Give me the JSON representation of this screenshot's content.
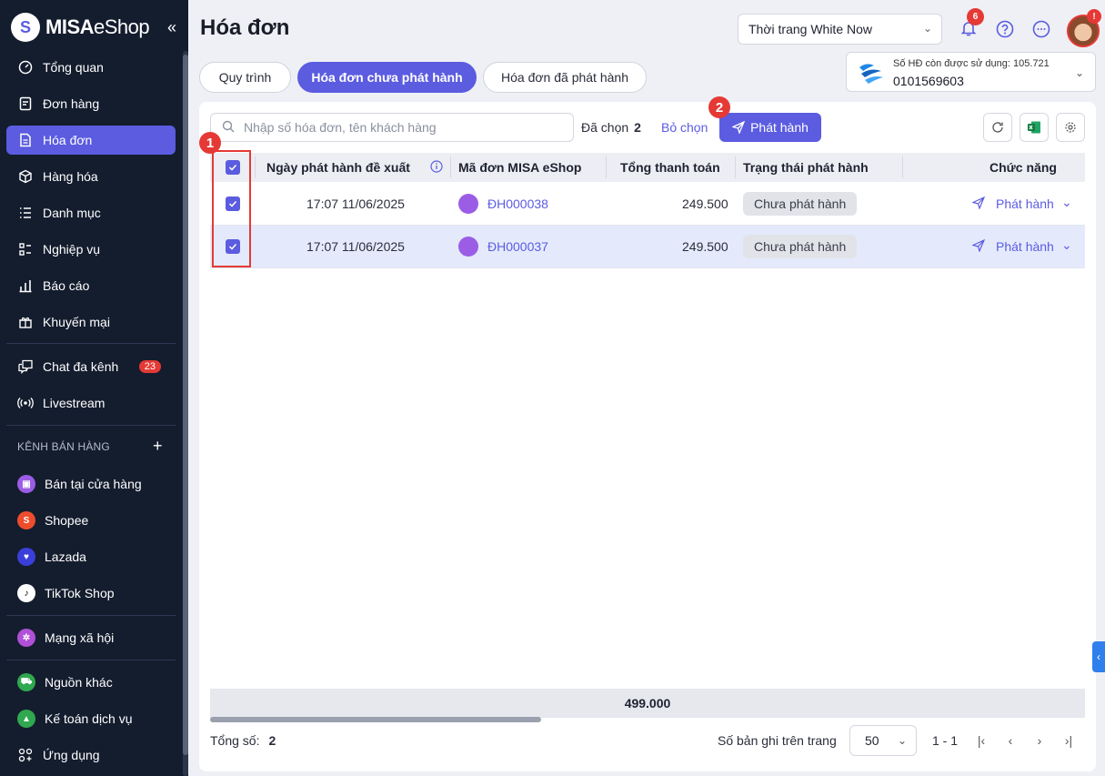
{
  "app": {
    "logo_main": "MISA",
    "logo_sub": "eShop",
    "collapse": "«"
  },
  "sidebar": {
    "items": [
      {
        "label": "Tổng quan"
      },
      {
        "label": "Đơn hàng"
      },
      {
        "label": "Hóa đơn"
      },
      {
        "label": "Hàng hóa"
      },
      {
        "label": "Danh mục"
      },
      {
        "label": "Nghiệp vụ"
      },
      {
        "label": "Báo cáo"
      },
      {
        "label": "Khuyến mại"
      },
      {
        "label": "Chat đa kênh",
        "badge": "23"
      },
      {
        "label": "Livestream"
      }
    ],
    "section_title": "KÊNH BÁN HÀNG",
    "section_add": "+",
    "channels": [
      {
        "label": "Bán tại cửa hàng",
        "color": "#9b5de5"
      },
      {
        "label": "Shopee",
        "color": "#ee4d2d"
      },
      {
        "label": "Lazada",
        "color": "#3a3fd9"
      },
      {
        "label": "TikTok Shop",
        "color": "#000000"
      },
      {
        "label": "Mạng xã hội",
        "color": "#b04fd8"
      },
      {
        "label": "Nguồn khác",
        "color": "#2fa84f"
      },
      {
        "label": "Kế toán dịch vụ",
        "color": "#2fa84f"
      },
      {
        "label": "Ứng dụng"
      }
    ]
  },
  "header": {
    "title": "Hóa đơn",
    "store": "Thời trang White Now",
    "notif_count": "6",
    "avatar_badge": "!"
  },
  "tabs": [
    {
      "label": "Quy trình"
    },
    {
      "label": "Hóa đơn chưa phát hành"
    },
    {
      "label": "Hóa đơn đã phát hành"
    }
  ],
  "invoice_box": {
    "remaining": "Số HĐ còn được sử dụng: 105.721",
    "tax_code": "0101569603"
  },
  "toolbar": {
    "search_placeholder": "Nhập số hóa đơn, tên khách hàng",
    "selected_label": "Đã chọn",
    "selected_count": "2",
    "deselect": "Bỏ chọn",
    "publish": "Phát hành"
  },
  "table": {
    "columns": [
      "Ngày phát hành đề xuất",
      "Mã đơn MISA eShop",
      "Tổng thanh toán",
      "Trạng thái phát hành",
      "Chức năng"
    ],
    "rows": [
      {
        "date": "17:07 11/06/2025",
        "order": "ĐH000038",
        "total": "249.500",
        "status": "Chưa phát hành",
        "action": "Phát hành"
      },
      {
        "date": "17:07 11/06/2025",
        "order": "ĐH000037",
        "total": "249.500",
        "status": "Chưa phát hành",
        "action": "Phát hành"
      }
    ],
    "sum": "499.000"
  },
  "footer": {
    "total_label": "Tổng số:",
    "total_value": "2",
    "per_page_label": "Số bản ghi trên trang",
    "per_page": "50",
    "range": "1 - 1"
  },
  "annotations": {
    "one": "1",
    "two": "2"
  },
  "colors": {
    "accent": "#5b5ce0",
    "sidebar": "#141d2e",
    "annotation": "#e53935"
  }
}
